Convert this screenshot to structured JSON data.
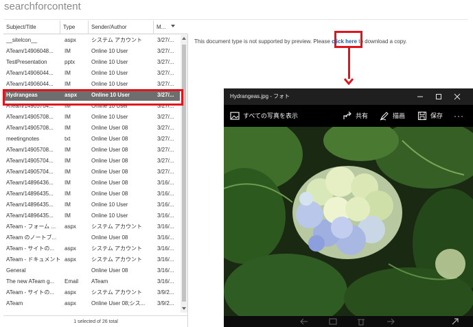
{
  "app": {
    "search_title": "searchforcontent"
  },
  "columns": [
    {
      "label": "Subject/Title"
    },
    {
      "label": "Type"
    },
    {
      "label": "Sender/Author"
    },
    {
      "label": "M..."
    }
  ],
  "rows": [
    {
      "subject": "__sitelcon__",
      "type": "aspx",
      "sender": "システム アカウント",
      "modified": "3/27/..."
    },
    {
      "subject": "ATeam/14906048...",
      "type": "IM",
      "sender": "Online 10 User",
      "modified": "3/27/..."
    },
    {
      "subject": "TestPresentation",
      "type": "pptx",
      "sender": "Online 10 User",
      "modified": "3/27/..."
    },
    {
      "subject": "ATeam/14906044...",
      "type": "IM",
      "sender": "Online 10 User",
      "modified": "3/27/..."
    },
    {
      "subject": "ATeam/14906044...",
      "type": "IM",
      "sender": "Online 10 User",
      "modified": "3/27/..."
    },
    {
      "subject": "Hydrangeas",
      "type": "aspx",
      "sender": "Online 10 User",
      "modified": "3/27/..."
    },
    {
      "subject": "ATeam/14905704...",
      "type": "IM",
      "sender": "Online 10 User",
      "modified": "3/27/..."
    },
    {
      "subject": "ATeam/14905708...",
      "type": "IM",
      "sender": "Online 10 User",
      "modified": "3/27/..."
    },
    {
      "subject": "ATeam/14905708...",
      "type": "IM",
      "sender": "Online User 08",
      "modified": "3/27/..."
    },
    {
      "subject": "meetingnotes",
      "type": "txt",
      "sender": "Online User 08",
      "modified": "3/27/..."
    },
    {
      "subject": "ATeam/14905708...",
      "type": "IM",
      "sender": "Online User 08",
      "modified": "3/27/..."
    },
    {
      "subject": "ATeam/14905704...",
      "type": "IM",
      "sender": "Online User 08",
      "modified": "3/27/..."
    },
    {
      "subject": "ATeam/14905704...",
      "type": "IM",
      "sender": "Online User 08",
      "modified": "3/27/..."
    },
    {
      "subject": "ATeam/14896436...",
      "type": "IM",
      "sender": "Online User 08",
      "modified": "3/16/..."
    },
    {
      "subject": "ATeam/14896435...",
      "type": "IM",
      "sender": "Online User 08",
      "modified": "3/16/..."
    },
    {
      "subject": "ATeam/14896435...",
      "type": "IM",
      "sender": "Online 10 User",
      "modified": "3/16/..."
    },
    {
      "subject": "ATeam/14896435...",
      "type": "IM",
      "sender": "Online 10 User",
      "modified": "3/16/..."
    },
    {
      "subject": "ATeam - フォーム ...",
      "type": "aspx",
      "sender": "システム アカウント",
      "modified": "3/16/..."
    },
    {
      "subject": "ATeam のノートブ...",
      "type": "",
      "sender": "Online User 08",
      "modified": "3/16/..."
    },
    {
      "subject": "ATeam - サイトの...",
      "type": "aspx",
      "sender": "システム アカウント",
      "modified": "3/16/..."
    },
    {
      "subject": "ATeam - ドキュメント",
      "type": "aspx",
      "sender": "システム アカウント",
      "modified": "3/16/..."
    },
    {
      "subject": "General",
      "type": "",
      "sender": "Online User 08",
      "modified": "3/16/..."
    },
    {
      "subject": "The new ATeam g...",
      "type": "Email",
      "sender": "ATeam",
      "modified": "3/16/..."
    },
    {
      "subject": "ATeam - サイトの...",
      "type": "aspx",
      "sender": "システム アカウント",
      "modified": "3/9/2..."
    },
    {
      "subject": "ATeam",
      "type": "aspx",
      "sender": "Online User 08;シス...",
      "modified": "3/9/2..."
    }
  ],
  "selected_index": 5,
  "footer": {
    "status": "1 selected of 26 total"
  },
  "preview": {
    "message_before": "This document type is not supported by preview. Please ",
    "link_text": "click here",
    "message_after": " to download a copy."
  },
  "photo_window": {
    "title": "Hydrangeas.jpg - フォト",
    "toolbar": {
      "gallery_label": "すべての写真を表示",
      "share_label": "共有",
      "draw_label": "描画",
      "save_label": "保存"
    }
  },
  "colors": {
    "highlight": "#e0141c",
    "link": "#1b5fb8",
    "selected_row": "#6e6e6e"
  },
  "icons": [
    "sort-down-icon",
    "gallery-icon",
    "share-icon",
    "pen-icon",
    "save-icon",
    "more-icon",
    "minimize-icon",
    "maximize-icon",
    "close-icon",
    "arrow-down-icon"
  ]
}
